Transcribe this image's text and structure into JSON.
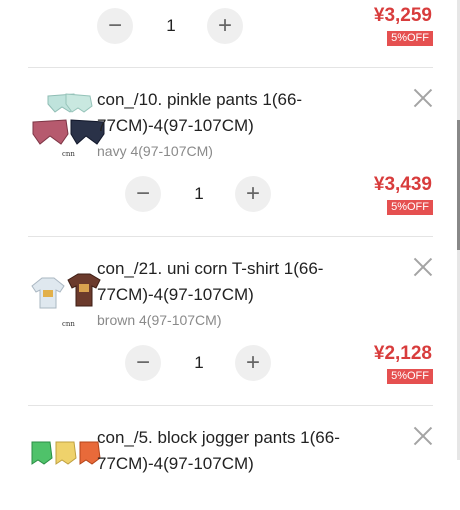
{
  "items": [
    {
      "title": "",
      "variant": "",
      "quantity": "1",
      "price": "¥3,259",
      "discount": "5%OFF",
      "icons": {
        "minus": "minus-icon",
        "plus": "plus-icon"
      }
    },
    {
      "title": "con_/10. pinkle pants 1(66-77CM)-4(97-107CM)",
      "variant": "navy 4(97-107CM)",
      "quantity": "1",
      "price": "¥3,439",
      "discount": "5%OFF",
      "thumb_text": "cnn"
    },
    {
      "title": "con_/21. uni corn T-shirt 1(66-77CM)-4(97-107CM)",
      "variant": "brown 4(97-107CM)",
      "quantity": "1",
      "price": "¥2,128",
      "discount": "5%OFF",
      "thumb_text": "cnn"
    },
    {
      "title": "con_/5. block jogger pants 1(66-77CM)-4(97-107CM)",
      "variant": "",
      "quantity": "",
      "price": "",
      "discount": ""
    }
  ],
  "colors": {
    "price": "#d83c3c",
    "badge": "#e55050",
    "stepper_bg": "#efefef"
  }
}
